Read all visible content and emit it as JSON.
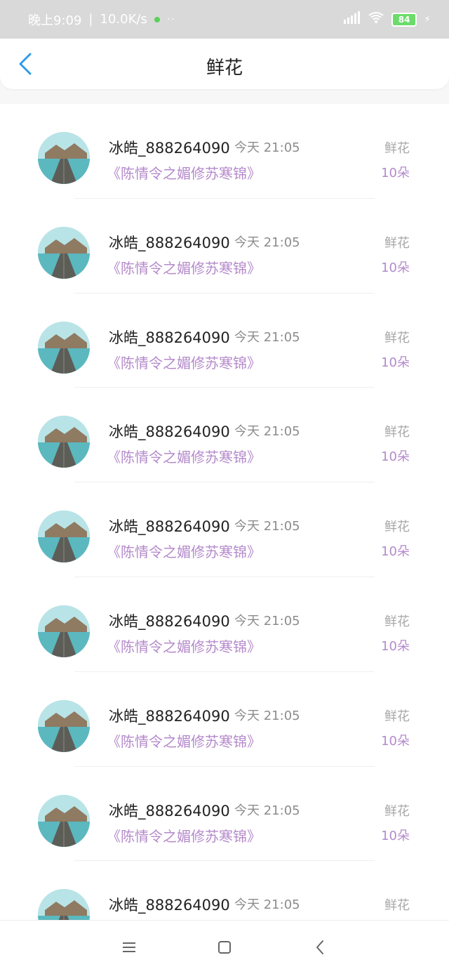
{
  "status_bar": {
    "time": "晚上9:09",
    "speed": "10.0K/s",
    "extra": "··",
    "battery": "84"
  },
  "header": {
    "title": "鲜花"
  },
  "rows": [
    {
      "name": "冰皓_888264090",
      "time": "今天 21:05",
      "book": "《陈情令之媚修苏寒锦》",
      "gift": "鲜花",
      "count": "10朵"
    },
    {
      "name": "冰皓_888264090",
      "time": "今天 21:05",
      "book": "《陈情令之媚修苏寒锦》",
      "gift": "鲜花",
      "count": "10朵"
    },
    {
      "name": "冰皓_888264090",
      "time": "今天 21:05",
      "book": "《陈情令之媚修苏寒锦》",
      "gift": "鲜花",
      "count": "10朵"
    },
    {
      "name": "冰皓_888264090",
      "time": "今天 21:05",
      "book": "《陈情令之媚修苏寒锦》",
      "gift": "鲜花",
      "count": "10朵"
    },
    {
      "name": "冰皓_888264090",
      "time": "今天 21:05",
      "book": "《陈情令之媚修苏寒锦》",
      "gift": "鲜花",
      "count": "10朵"
    },
    {
      "name": "冰皓_888264090",
      "time": "今天 21:05",
      "book": "《陈情令之媚修苏寒锦》",
      "gift": "鲜花",
      "count": "10朵"
    },
    {
      "name": "冰皓_888264090",
      "time": "今天 21:05",
      "book": "《陈情令之媚修苏寒锦》",
      "gift": "鲜花",
      "count": "10朵"
    },
    {
      "name": "冰皓_888264090",
      "time": "今天 21:05",
      "book": "《陈情令之媚修苏寒锦》",
      "gift": "鲜花",
      "count": "10朵"
    },
    {
      "name": "冰皓_888264090",
      "time": "今天 21:05",
      "book": "",
      "gift": "鲜花",
      "count": ""
    }
  ],
  "icons": {
    "back": "back-arrow-icon",
    "menu": "menu-icon",
    "home": "home-square-icon",
    "nav_back": "nav-back-icon",
    "signal": "signal-icon",
    "wifi": "wifi-icon"
  },
  "colors": {
    "accent": "#2e9bf0",
    "book": "#b48acb"
  }
}
